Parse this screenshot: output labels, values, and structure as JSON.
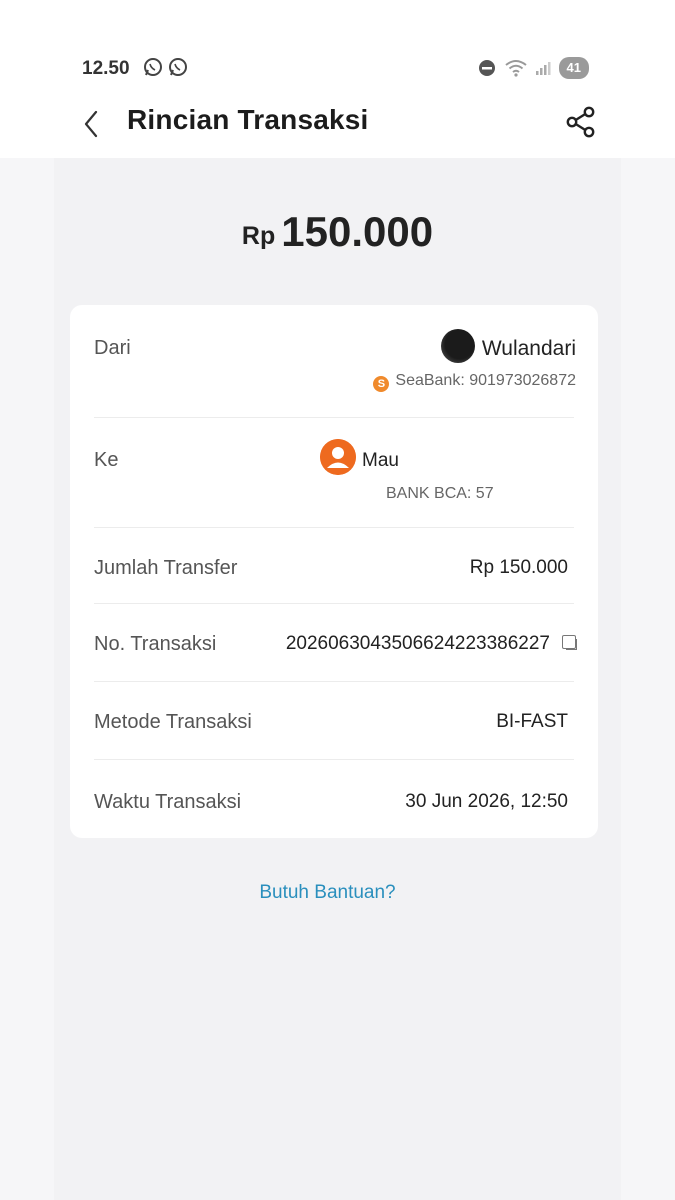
{
  "status": {
    "time": "12.50",
    "battery": "41"
  },
  "header": {
    "title": "Rincian Transaksi"
  },
  "amount": {
    "currency": "Rp",
    "value": "150.000"
  },
  "details": {
    "from": {
      "label": "Dari",
      "name": "Wulandari",
      "bank": "SeaBank: 901973026872"
    },
    "to": {
      "label": "Ke",
      "name": "Mau",
      "bank": "BANK BCA: 57"
    },
    "amount": {
      "label": "Jumlah Transfer",
      "value": "Rp 150.000"
    },
    "txn_no": {
      "label": "No. Transaksi",
      "value": "20260630435066242233862​27"
    },
    "method": {
      "label": "Metode Transaksi",
      "value": "BI-FAST"
    },
    "time": {
      "label": "Waktu Transaksi",
      "value": "30 Jun 2026, 12:50"
    }
  },
  "help": {
    "label": "Butuh Bantuan?"
  },
  "colors": {
    "accent": "#2a8fbd",
    "avatar": "#ee6a1f",
    "seabank": "#f08a2c"
  }
}
